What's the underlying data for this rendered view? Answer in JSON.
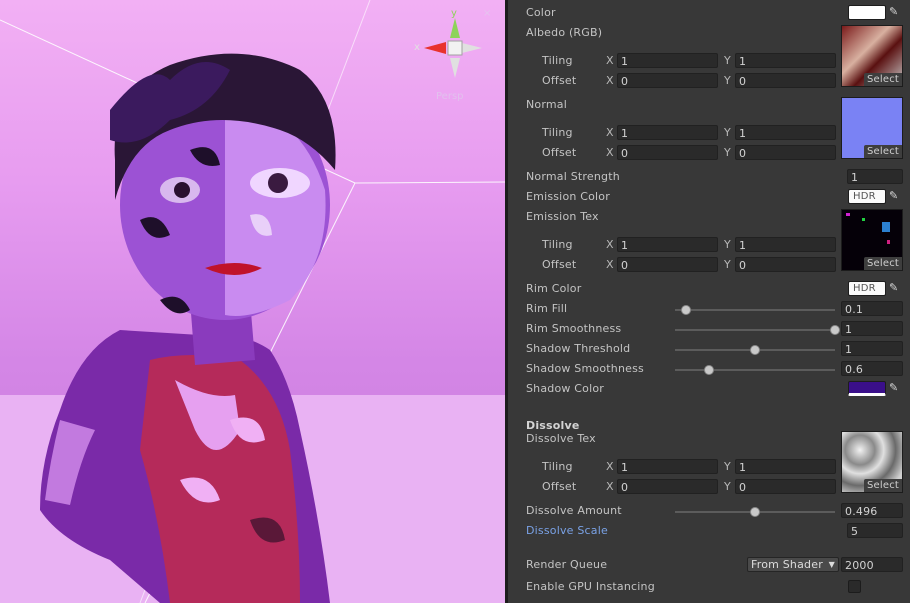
{
  "scene": {
    "gizmo": {
      "y_label": "y",
      "x_label": "x",
      "mode_label": "Persp"
    }
  },
  "inspector": {
    "color": {
      "label": "Color",
      "value_color": "#ffffff"
    },
    "albedo": {
      "label": "Albedo (RGB)",
      "tiling_label": "Tiling",
      "offset_label": "Offset",
      "tiling_x": "1",
      "tiling_y": "1",
      "offset_x": "0",
      "offset_y": "0",
      "select_label": "Select"
    },
    "normal": {
      "label": "Normal",
      "tiling_label": "Tiling",
      "offset_label": "Offset",
      "tiling_x": "1",
      "tiling_y": "1",
      "offset_x": "0",
      "offset_y": "0",
      "select_label": "Select"
    },
    "normal_strength": {
      "label": "Normal Strength",
      "value": "1"
    },
    "emission_color": {
      "label": "Emission Color",
      "hdr": "HDR"
    },
    "emission_tex": {
      "label": "Emission Tex",
      "tiling_label": "Tiling",
      "offset_label": "Offset",
      "tiling_x": "1",
      "tiling_y": "1",
      "offset_x": "0",
      "offset_y": "0",
      "select_label": "Select"
    },
    "rim_color": {
      "label": "Rim Color",
      "hdr": "HDR"
    },
    "rim_fill": {
      "label": "Rim Fill",
      "value": "0.1",
      "fraction": 0.07
    },
    "rim_smoothness": {
      "label": "Rim Smoothness",
      "value": "1",
      "fraction": 1.0
    },
    "shadow_threshold": {
      "label": "Shadow Threshold",
      "value": "1",
      "fraction": 0.5
    },
    "shadow_smoothness": {
      "label": "Shadow Smoothness",
      "value": "0.6",
      "fraction": 0.21
    },
    "shadow_color": {
      "label": "Shadow Color",
      "value_color": "#3a0f8a"
    },
    "dissolve": {
      "section": "Dissolve",
      "tex_label": "Dissolve Tex",
      "tiling_label": "Tiling",
      "offset_label": "Offset",
      "tiling_x": "1",
      "tiling_y": "1",
      "offset_x": "0",
      "offset_y": "0",
      "select_label": "Select"
    },
    "dissolve_amount": {
      "label": "Dissolve Amount",
      "value": "0.496",
      "fraction": 0.5
    },
    "dissolve_scale": {
      "label": "Dissolve Scale",
      "value": "5"
    },
    "render_queue": {
      "label": "Render Queue",
      "dropdown": "From Shader",
      "value": "2000"
    },
    "gpu_instancing": {
      "label": "Enable GPU Instancing",
      "checked": false
    },
    "xy": {
      "x": "X",
      "y": "Y"
    }
  }
}
